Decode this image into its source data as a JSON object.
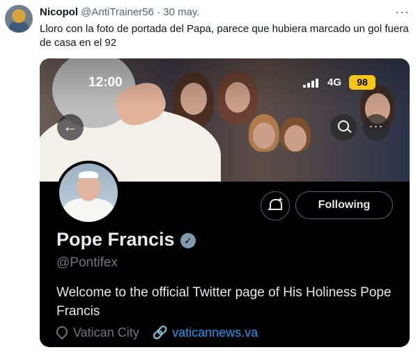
{
  "tweet": {
    "display_name": "Nicopol",
    "handle": "@AntiTrainer56",
    "separator": "·",
    "date": "30 may.",
    "text": "Lloro con la foto de portada del Papa, parece que hubiera marcado un gol fuera de casa en el 92",
    "more_icon": "more-horizontal-icon"
  },
  "phone_status": {
    "time": "12:00",
    "network": "4G",
    "battery": "98",
    "battery_color": "#f5c518"
  },
  "profile": {
    "name": "Pope Francis",
    "verified_color": "#829aab",
    "handle": "@Pontifex",
    "bio": "Welcome to the official Twitter page of His Holiness Pope Francis",
    "location": "Vatican City",
    "website": "vaticannews.va",
    "following_label": "Following",
    "link_color": "#1d9bf0"
  }
}
